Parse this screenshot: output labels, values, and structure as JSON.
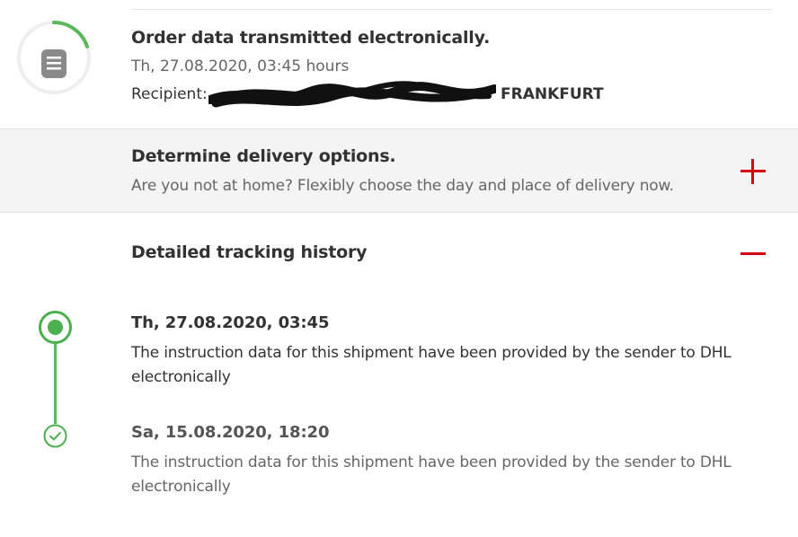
{
  "status": {
    "icon": "document-icon",
    "title": "Order data transmitted electronically.",
    "date": "Th, 27.08.2020, 03:45 hours",
    "recipient_label": "Recipient:",
    "recipient_city": "FRANKFURT",
    "progress_fraction": 0.2
  },
  "delivery_options": {
    "title": "Determine delivery options.",
    "description": "Are you not at home? Flexibly choose the day and place of delivery now.",
    "icon": "plus-icon"
  },
  "tracking_history": {
    "title": "Detailed tracking history",
    "icon": "minus-icon",
    "events": [
      {
        "date": "Th, 27.08.2020, 03:45",
        "text": "The instruction data for this shipment have been provided by the sender to DHL electronically",
        "icon": "current-status-icon"
      },
      {
        "date": "Sa, 15.08.2020, 18:20",
        "text": "The instruction data for this shipment have been provided by the sender to DHL electronically",
        "icon": "checkmark-icon"
      }
    ]
  },
  "colors": {
    "accent_red": "#d40511",
    "success_green": "#4caf50",
    "text_dark": "#323232",
    "text_muted": "#666666",
    "panel_bg": "#f4f4f4"
  }
}
